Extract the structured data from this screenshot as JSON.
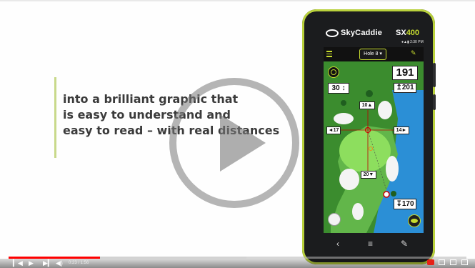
{
  "headline": {
    "line1": "into a brilliant graphic that",
    "line2": "is easy to understand and",
    "line3": "easy to read – with real distances"
  },
  "phone": {
    "brand": "SkyCaddie",
    "model_prefix": "SX",
    "model_number": "400",
    "status_time": "2:30 PM",
    "hole_label": "Hole 8",
    "distances": {
      "main": "191",
      "plus": "↥201",
      "wind": "30 ↕",
      "up": "10▲",
      "left": "◄17",
      "right": "14►",
      "down": "20▼",
      "low": "↧170"
    },
    "icons": [
      "menu-icon",
      "edit-icon",
      "target-icon",
      "eye-icon",
      "golf-ball-icon"
    ],
    "nav": {
      "back": "‹",
      "home": "≡",
      "edit": "✎"
    }
  },
  "video": {
    "time": "0:23 / 1:56",
    "progress_fraction": 0.2,
    "buffer_fraction": 0.52,
    "icons": [
      "play-icon",
      "skip-back-icon",
      "next-icon",
      "volume-icon",
      "settings-icon",
      "miniplayer-icon",
      "theater-icon",
      "fullscreen-icon"
    ],
    "colors": {
      "progress": "#ff0000",
      "accent": "#c7dc2f"
    }
  }
}
